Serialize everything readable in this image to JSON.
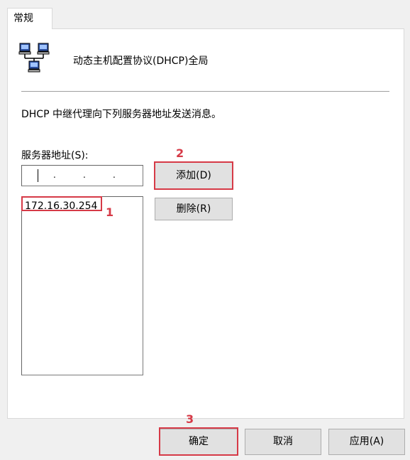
{
  "tab": {
    "label": "常规"
  },
  "header": {
    "title": "动态主机配置协议(DHCP)全局"
  },
  "description": "DHCP 中继代理向下列服务器地址发送消息。",
  "server_section": {
    "label": "服务器地址(S):",
    "ip_input_dots": [
      ".",
      ".",
      "."
    ],
    "servers": [
      "172.16.30.254"
    ]
  },
  "buttons": {
    "add": "添加(D)",
    "remove": "删除(R)",
    "ok": "确定",
    "cancel": "取消",
    "apply": "应用(A)"
  },
  "annotations": {
    "step1": "1",
    "step2": "2",
    "step3": "3"
  },
  "colors": {
    "highlight": "#d63a47",
    "button_face": "#e1e1e1",
    "panel": "#ffffff",
    "window": "#f0f0f0"
  },
  "icons": {
    "header_icon": "network-computers-icon"
  }
}
